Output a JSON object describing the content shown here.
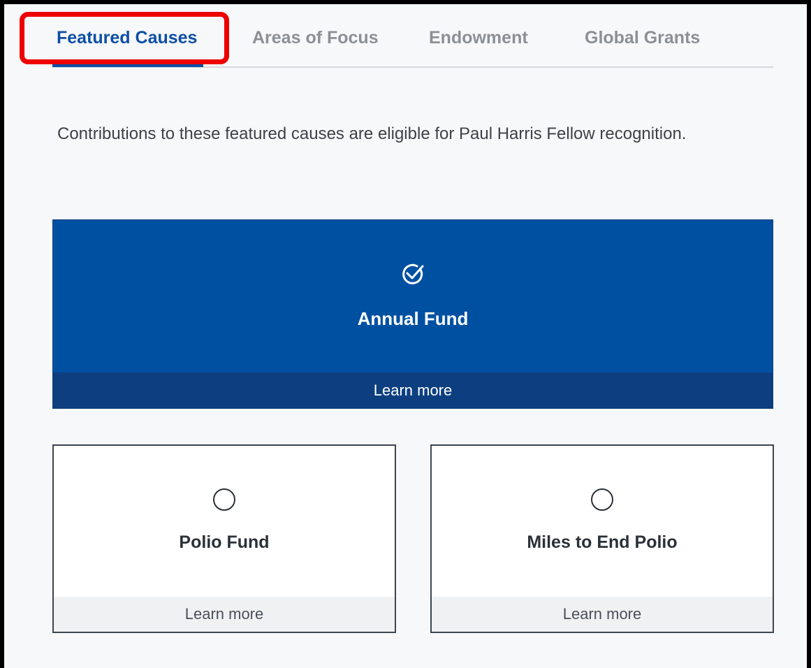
{
  "tabs": [
    {
      "label": "Featured Causes",
      "active": true
    },
    {
      "label": "Areas of Focus",
      "active": false
    },
    {
      "label": "Endowment",
      "active": false
    },
    {
      "label": "Global Grants",
      "active": false
    }
  ],
  "description": "Contributions to these featured causes are eligible for Paul Harris Fellow recognition.",
  "cards": [
    {
      "title": "Annual Fund",
      "link": "Learn more",
      "icon": "check-circle-icon",
      "selected": true
    },
    {
      "title": "Polio Fund",
      "link": "Learn more",
      "icon": "empty-circle-icon",
      "selected": false
    },
    {
      "title": "Miles to End Polio",
      "link": "Learn more",
      "icon": "empty-circle-icon",
      "selected": false
    }
  ],
  "colors": {
    "accent": "#0c4fa3",
    "primary_card": "#0050a2",
    "primary_card_footer": "#0d3f80",
    "highlight": "#ee0000"
  }
}
